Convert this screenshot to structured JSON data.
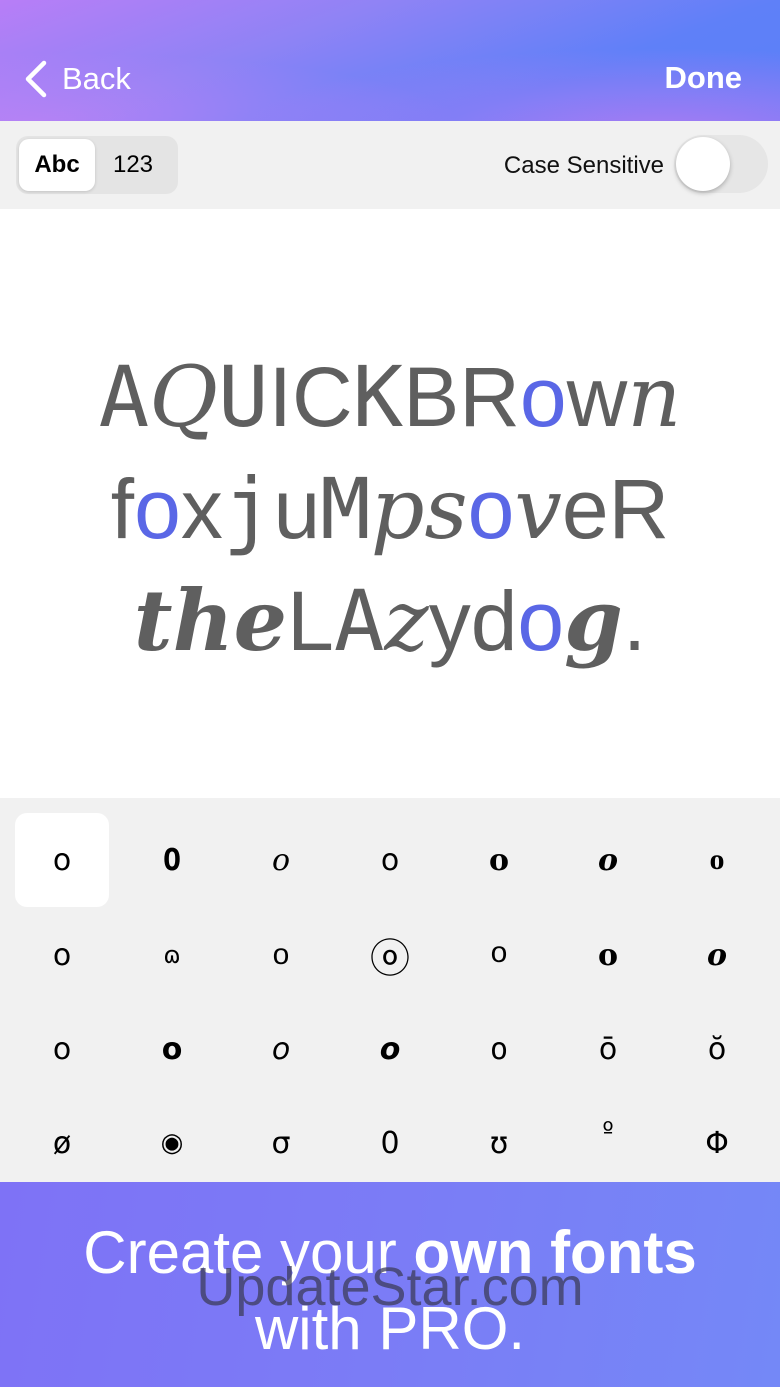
{
  "header": {
    "back_label": "Back",
    "done_label": "Done"
  },
  "toolbar": {
    "segments": [
      "Abc",
      "123"
    ],
    "active_segment": "Abc",
    "case_sensitive_label": "Case Sensitive",
    "case_sensitive_on": false
  },
  "preview": {
    "line1": [
      "A",
      " ",
      "Q",
      "U",
      "I",
      "C",
      "K",
      " ",
      "B",
      "R",
      "o",
      "w",
      "n"
    ],
    "line2": [
      "f",
      "o",
      "x",
      " ",
      "j",
      "u",
      "M",
      "ps",
      " ",
      "o",
      "v",
      "e",
      "R"
    ],
    "line3": [
      "the",
      " ",
      "L",
      "A",
      "z",
      "y",
      " ",
      "d",
      "o",
      "g",
      "."
    ],
    "highlight_color": "#5a67e6"
  },
  "glyphs": [
    [
      "o",
      "O",
      "o",
      "o",
      "o",
      "o",
      "o"
    ],
    [
      "o",
      "ɷ",
      "o",
      "ⓞ",
      "o",
      "o",
      "o"
    ],
    [
      "o",
      "o",
      "o",
      "o",
      "o",
      "ō",
      "ŏ"
    ],
    [
      "ø",
      "◉",
      "σ",
      "0",
      "ʊ",
      "º",
      "Φ"
    ]
  ],
  "promo": {
    "line1_regular": "Create your ",
    "line1_bold": "own fonts",
    "line2": "with PRO."
  },
  "watermark": "UpdateStar.com"
}
